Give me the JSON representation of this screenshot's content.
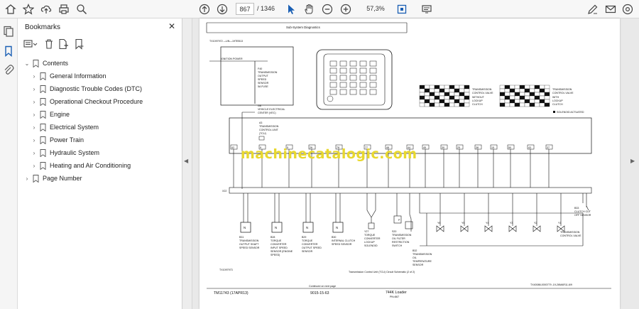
{
  "toolbar": {
    "icons": [
      "star-icon",
      "upload-icon",
      "print-icon",
      "zoom-search-icon",
      "page-up-icon",
      "page-down-icon",
      "select-cursor-icon",
      "hand-icon",
      "zoom-out-icon",
      "zoom-in-icon",
      "fit-page-icon",
      "more-tools-icon",
      "sign-icon",
      "email-icon",
      "settings-icon"
    ],
    "page_current": "867",
    "page_total": "/ 1346",
    "zoom": "57,3%"
  },
  "sidebar": {
    "title": "Bookmarks",
    "items": [
      {
        "label": "Contents",
        "level": 0
      },
      {
        "label": "General Information",
        "level": 1
      },
      {
        "label": "Diagnostic Trouble Codes (DTC)",
        "level": 1
      },
      {
        "label": "Operational Checkout Procedure",
        "level": 1
      },
      {
        "label": "Engine",
        "level": 1
      },
      {
        "label": "Electrical System",
        "level": 1
      },
      {
        "label": "Power Train",
        "level": 1
      },
      {
        "label": "Hydraulic System",
        "level": 1
      },
      {
        "label": "Heating and Air Conditioning",
        "level": 1
      },
      {
        "label": "Page Number",
        "level": 0
      }
    ]
  },
  "doc": {
    "header": "Sub-System Diagnostics",
    "small_code": "TX1097972 —UN—19TEB13",
    "ignition": "IGNITION POWER",
    "f40": [
      "F40",
      "TRANSMISSION",
      "OUTPUT",
      "SPEED",
      "SENSOR",
      "5A FUSE"
    ],
    "g8": [
      "G8",
      "VEHICLE ELECTRICAL",
      "CENTER (VEC)"
    ],
    "a3": [
      "A3",
      "TRANSMISSION",
      "CONTROL UNIT",
      "(TCU)"
    ],
    "x22": "X22",
    "table1_label": [
      "TRANSMISSION",
      "CONTROL VALVE",
      "",
      "WITHOUT",
      "LOCKUP",
      "CLUTCH"
    ],
    "table2_label": [
      "TRANSMISSION",
      "CONTROL VALVE",
      "",
      "WITH",
      "LOCKUP",
      "CLUTCH"
    ],
    "solenoid_note": "SOLENOID ACTUATED",
    "pins": [
      "42",
      "9",
      "5",
      "26",
      "78",
      "77",
      "48",
      "44",
      "45",
      "30",
      "25",
      "38",
      "15",
      "50",
      "43",
      "37"
    ],
    "b31": [
      "B31",
      "TRANSMISSION",
      "OUTPUT SHAFT",
      "SPEED SENSOR"
    ],
    "b28": [
      "B28",
      "TORQUE",
      "CONVERTER",
      "INPUT SPEED",
      "SENSOR (ENGINE",
      "SPEED)"
    ],
    "b29": [
      "B29",
      "TORQUE",
      "CONVERTER",
      "OUTPUT SPEED",
      "SENSOR"
    ],
    "b30": [
      "B30",
      "INTERNAL CLUTCH",
      "SPEED SENSOR"
    ],
    "y27": [
      "Y27",
      "TORQUE",
      "CONVERTER",
      "LOCKUP",
      "SOLENOID"
    ],
    "s20": [
      "S20",
      "TRANSMISSION",
      "OIL FILTER",
      "RESTRICTION",
      "SWITCH"
    ],
    "b32": [
      "B32",
      "TRANSMISSION",
      "OIL",
      "TEMPERATURE",
      "SENSOR"
    ],
    "b33": [
      "B33",
      "CLUTCH CUT",
      "OFF SENSOR"
    ],
    "tcv": [
      "TRANSMISSION",
      "CONTROL VALVE"
    ],
    "valves": [
      "Y6",
      "Y5",
      "Y4",
      "Y3",
      "Y2",
      "Y1"
    ],
    "sensor_letter": "N",
    "switch_letter": "P",
    "ref_left": "TX1097973",
    "continued": "Continued on next page",
    "caption": "Transmission Control Unit (TCU) Circuit Schematic (2 of 2)",
    "ref_right": "TX40086,0000779 -19-26MAR11-6/9",
    "footer_left": "TM11743 (17APR13)",
    "footer_center": "9015-15-63",
    "footer_right1": "744K Loader",
    "footer_right2": "PN=867",
    "watermark": "machinecatalogic.com"
  }
}
